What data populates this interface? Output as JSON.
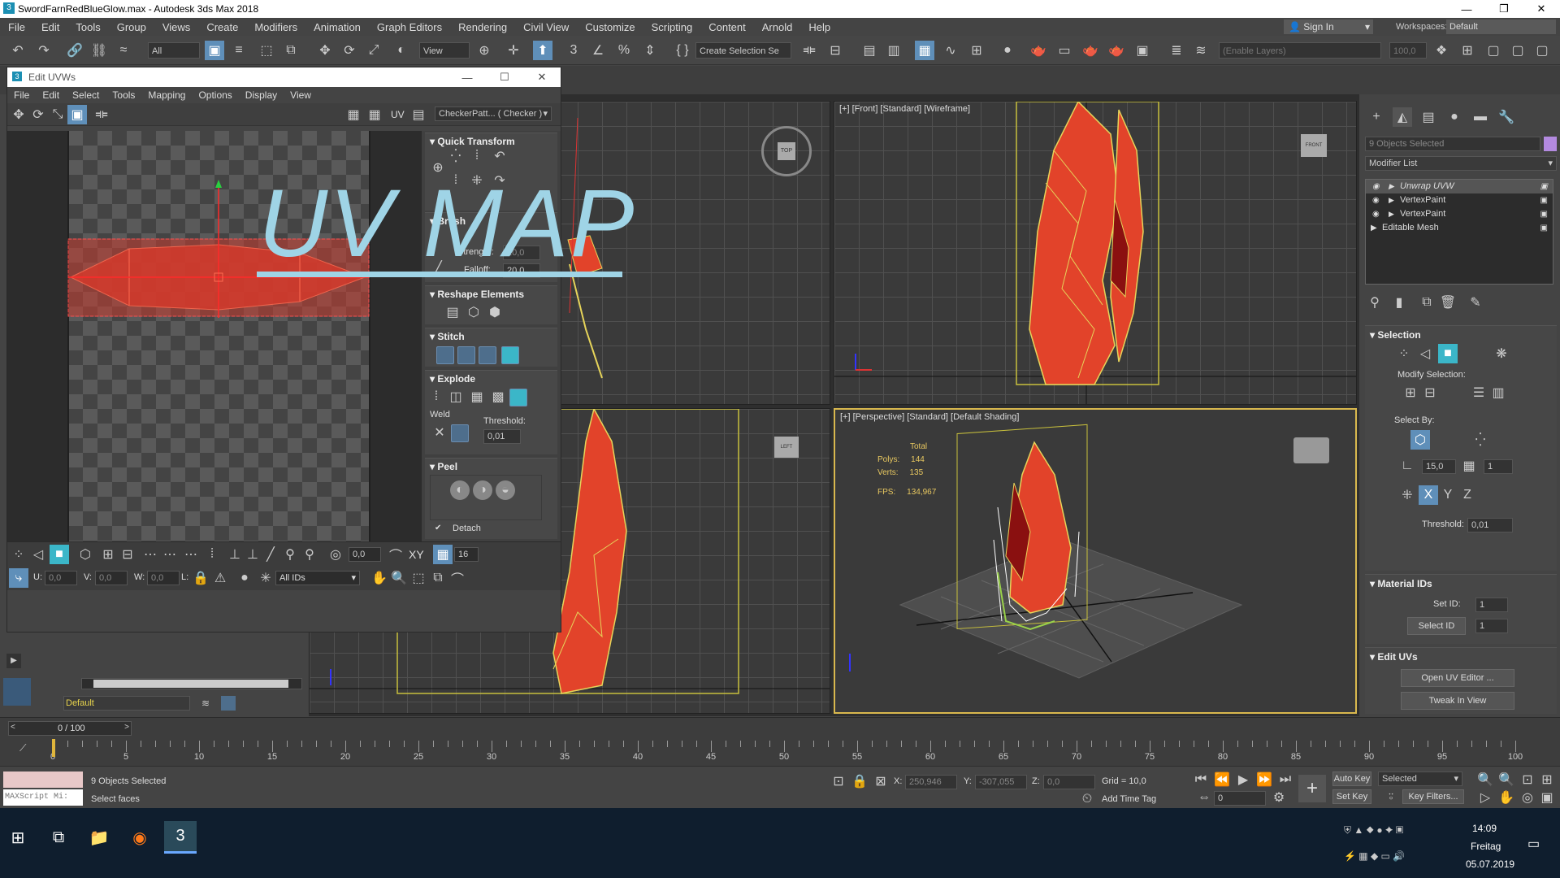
{
  "window": {
    "title": "SwordFarnRedBlueGlow.max - Autodesk 3ds Max 2018",
    "controls": [
      "—",
      "❐",
      "✕"
    ]
  },
  "menubar": {
    "items": [
      "File",
      "Edit",
      "Tools",
      "Group",
      "Views",
      "Create",
      "Modifiers",
      "Animation",
      "Graph Editors",
      "Rendering",
      "Civil View",
      "Customize",
      "Scripting",
      "Content",
      "Arnold",
      "Help"
    ],
    "signin": "Sign In",
    "workspaces_label": "Workspaces:",
    "workspaces_value": "Default"
  },
  "toolbar": {
    "filter": "All",
    "view": "View",
    "create_selection": "Create Selection Se",
    "layers": "(Enable Layers)",
    "zoom": "100,0"
  },
  "uv_editor": {
    "title": "Edit UVWs",
    "menu": [
      "File",
      "Edit",
      "Select",
      "Tools",
      "Mapping",
      "Options",
      "Display",
      "View"
    ],
    "uv_label": "UV",
    "checker": "CheckerPatt... ( Checker )",
    "sections": {
      "quick_transform": "Quick Transform",
      "brush": "Brush",
      "strength_label": "Strength:",
      "strength": "10,0",
      "falloff_label": "Falloff:",
      "falloff": "20,0",
      "reshape": "Reshape Elements",
      "stitch": "Stitch",
      "explode": "Explode",
      "weld": "Weld",
      "threshold_label": "Threshold:",
      "threshold": "0,01",
      "peel": "Peel",
      "detach": "Detach"
    },
    "bottom": {
      "spin1": "0,0",
      "spin2": "16",
      "xy": "XY",
      "u_label": "U:",
      "u": "0,0",
      "v_label": "V:",
      "v": "0,0",
      "w_label": "W:",
      "w": "0,0",
      "l_label": "L:",
      "ids": "All IDs"
    }
  },
  "overlay": {
    "text": "UV MAP"
  },
  "viewports": {
    "front": "[+] [Front] [Standard] [Wireframe]",
    "perspective": "[+] [Perspective] [Standard] [Default Shading]",
    "stats": {
      "total": "Total",
      "polys_label": "Polys:",
      "polys": "144",
      "verts_label": "Verts:",
      "verts": "135",
      "fps_label": "FPS:",
      "fps": "134,967"
    },
    "viewcube_front": "FRONT",
    "viewcube_left": "LEFT",
    "viewcube_top": "TOP"
  },
  "command_panel": {
    "selected": "9 Objects Selected",
    "modifier_list": "Modifier List",
    "modifiers": [
      "Unwrap UVW",
      "VertexPaint",
      "VertexPaint",
      "Editable Mesh"
    ],
    "selection_header": "Selection",
    "modify_selection": "Modify Selection:",
    "select_by": "Select By:",
    "angle": "15,0",
    "count": "1",
    "threshold_label": "Threshold:",
    "threshold": "0,01",
    "material_header": "Material IDs",
    "set_id_label": "Set ID:",
    "set_id": "1",
    "select_id_btn": "Select ID",
    "select_id": "1",
    "edit_uvs_header": "Edit UVs",
    "open_uv_btn": "Open UV Editor ...",
    "tweak_btn": "Tweak In View"
  },
  "left_panel": {
    "layer": "Default"
  },
  "timeline": {
    "frame": "0 / 100",
    "ticks": [
      0,
      5,
      10,
      15,
      20,
      25,
      30,
      35,
      40,
      45,
      50,
      55,
      60,
      65,
      70,
      75,
      80,
      85,
      90,
      95,
      100
    ]
  },
  "statusbar": {
    "selected": "9 Objects Selected",
    "prompt": "Select faces",
    "maxscript": "MAXScript Mi:",
    "x_label": "X:",
    "x": "250,946",
    "y_label": "Y:",
    "y": "-307,055",
    "z_label": "Z:",
    "z": "0,0",
    "grid": "Grid = 10,0",
    "add_time_tag": "Add Time Tag",
    "auto_key": "Auto Key",
    "set_key": "Set Key",
    "selected_dd": "Selected",
    "key_filters": "Key Filters...",
    "frame_field": "0"
  },
  "taskbar": {
    "time": "14:09",
    "day": "Freitag",
    "date": "05.07.2019"
  }
}
